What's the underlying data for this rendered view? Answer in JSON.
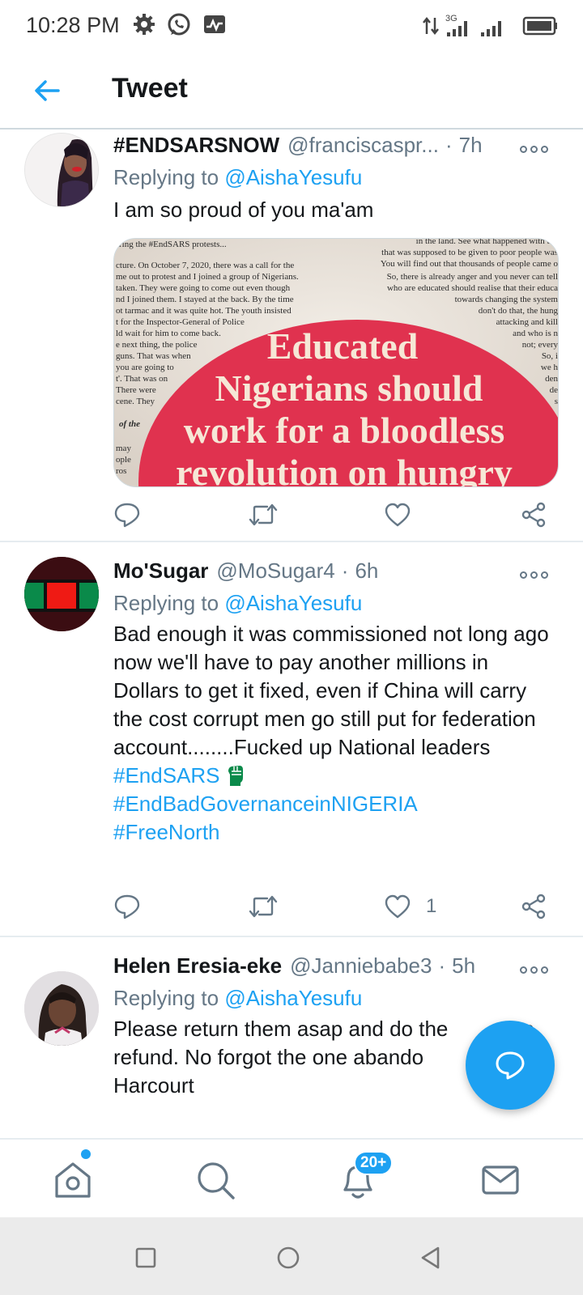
{
  "status_bar": {
    "time": "10:28 PM",
    "network": "3G"
  },
  "header": {
    "title": "Tweet"
  },
  "tweets": [
    {
      "name": "#ENDSARSNOW",
      "handle": "@franciscaspr...",
      "time": "7h",
      "reply_prefix": "Replying to",
      "reply_to": "@AishaYesufu",
      "text": "I am so proud of you ma'am",
      "hashtags": [],
      "likes": "",
      "media": {
        "headline_lines": [
          "Educated",
          "Nigerians should",
          "work for a bloodless",
          "revolution on hungry"
        ],
        "left_column": [
          "ring the #EndSARS protests...",
          "cture. On October 7, 2020, there was a call for the",
          "me out to protest and I joined a group of Nigerians.",
          "taken. They were going to come out even though",
          "nd I joined them. I stayed at the back. By the time",
          "ot tarmac and it was quite hot. The youth insisted",
          "t for the Inspector-General of Police",
          "ld wait for him to come back.",
          "e next thing, the police",
          "guns. That was when",
          "you are going to",
          "t'. That was on",
          "There were",
          "cene. They",
          "of the",
          "may",
          "ople",
          "ros"
        ],
        "right_column": [
          "in the land. See what happened with the",
          "that was supposed to be given to poor people was",
          "You will find out that thousands of people came o",
          "So, there is already anger and you never can tell",
          "who are educated should realise that their educa",
          "towards changing the system",
          "don't do that, the hung",
          "attacking and kill",
          "and who is n",
          "not; every",
          "So, i",
          "we h",
          "den",
          "de",
          "s"
        ]
      }
    },
    {
      "name": "Mo'Sugar",
      "handle": "@MoSugar4",
      "time": "6h",
      "reply_prefix": "Replying to",
      "reply_to": "@AishaYesufu",
      "text": "Bad enough it was commissioned not long ago now we'll have to pay another millions in Dollars to get it fixed, even if China will carry the cost corrupt men go still put for federation account........Fucked up National leaders",
      "hashtags": [
        "#EndSARS",
        "#EndBadGovernanceinNIGERIA",
        "#FreeNorth"
      ],
      "likes": "1"
    },
    {
      "name": "Helen Eresia-eke",
      "handle": "@Janniebabe3",
      "time": "5h",
      "reply_prefix": "Replying to",
      "reply_to": "@AishaYesufu",
      "text": "Please return them asap and do the          y a refund. No forgot the one abando          Port Harcourt",
      "hashtags": [],
      "likes": ""
    }
  ],
  "bottom_nav": {
    "notifications_badge": "20+"
  },
  "colors": {
    "accent": "#1da1f2",
    "text_primary": "#14171a",
    "text_secondary": "#657786",
    "divider": "#e6ecf0"
  },
  "icons": [
    "settings-icon",
    "whatsapp-icon",
    "activity-icon",
    "data-arrows-icon",
    "signal-icon",
    "battery-icon",
    "back-arrow-icon",
    "more-icon",
    "reply-icon",
    "retweet-icon",
    "like-icon",
    "share-icon",
    "compose-reply-icon",
    "home-icon",
    "search-icon",
    "notifications-icon",
    "messages-icon",
    "recents-icon",
    "home-circle-icon",
    "back-triangle-icon"
  ]
}
